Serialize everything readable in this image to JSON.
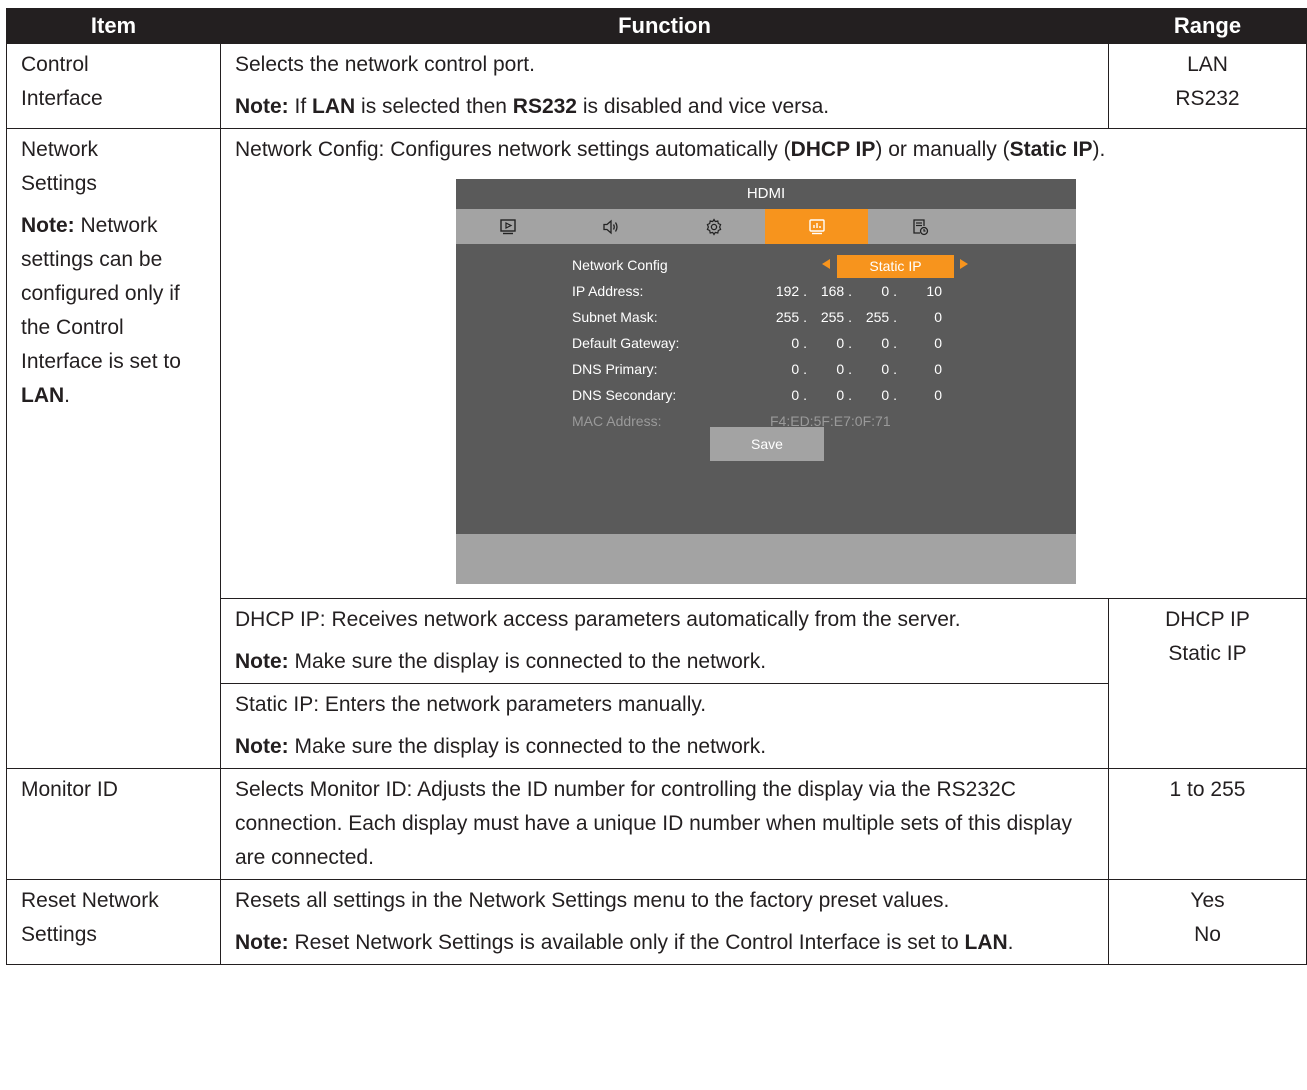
{
  "headers": {
    "item": "Item",
    "function": "Function",
    "range": "Range"
  },
  "control": {
    "item": "Control Interface",
    "function": "Selects the network control port.",
    "note_label": "Note:",
    "note_pre": " If ",
    "note_b1": "LAN",
    "note_mid": " is selected then ",
    "note_b2": "RS232",
    "note_post": " is disabled and vice versa.",
    "range": [
      "LAN",
      "RS232"
    ]
  },
  "network": {
    "item": "Network Settings",
    "note_label": "Note:",
    "note_text": " Network settings can be configured only if the Control Interface is set to ",
    "note_bold": "LAN",
    "note_end": ".",
    "config_pre": "Network Config: Configures network settings automatically (",
    "config_b1": "DHCP IP",
    "config_mid": ") or manually (",
    "config_b2": "Static IP",
    "config_post": ")."
  },
  "osd": {
    "title": "HDMI",
    "tabs": [
      {
        "icon": "picture-icon"
      },
      {
        "icon": "sound-icon"
      },
      {
        "icon": "settings-icon"
      },
      {
        "icon": "network-icon",
        "active": true
      },
      {
        "icon": "schedule-icon"
      }
    ],
    "network_config_label": "Network Config",
    "network_config_value": "Static IP",
    "rows": [
      {
        "label": "IP Address:",
        "values": [
          "192 .",
          "168 .",
          "0 .",
          "10"
        ]
      },
      {
        "label": "Subnet Mask:",
        "values": [
          "255 .",
          "255 .",
          "255 .",
          "0"
        ]
      },
      {
        "label": "Default Gateway:",
        "values": [
          "0 .",
          "0 .",
          "0 .",
          "0"
        ]
      },
      {
        "label": "DNS Primary:",
        "values": [
          "0 .",
          "0 .",
          "0 .",
          "0"
        ]
      },
      {
        "label": "DNS Secondary:",
        "values": [
          "0 .",
          "0 .",
          "0 .",
          "0"
        ]
      }
    ],
    "mac_label": "MAC Address:",
    "mac_value": "F4:ED:5F:E7:0F:71",
    "save_label": "Save"
  },
  "dhcp": {
    "text": "DHCP IP: Receives network access parameters automatically from the server.",
    "note_label": "Note:",
    "note_text": " Make sure the display is connected to the network.",
    "range": [
      "DHCP IP",
      "Static IP"
    ]
  },
  "static": {
    "text": "Static IP: Enters the network parameters manually.",
    "note_label": "Note:",
    "note_text": " Make sure the display is connected to the network."
  },
  "monitor": {
    "item": "Monitor ID",
    "text": "Selects Monitor ID: Adjusts the ID number for controlling the display via the RS232C connection. Each display must have a unique ID number when multiple sets of this display are connected.",
    "range": "1 to 255"
  },
  "reset": {
    "item": "Reset Network Settings",
    "text": "Resets all settings in the Network Settings menu to the factory preset values.",
    "note_label": "Note:",
    "note_text": " Reset Network Settings is available only if the Control Interface is set to ",
    "note_bold": "LAN",
    "note_end": ".",
    "range": [
      "Yes",
      "No"
    ]
  }
}
